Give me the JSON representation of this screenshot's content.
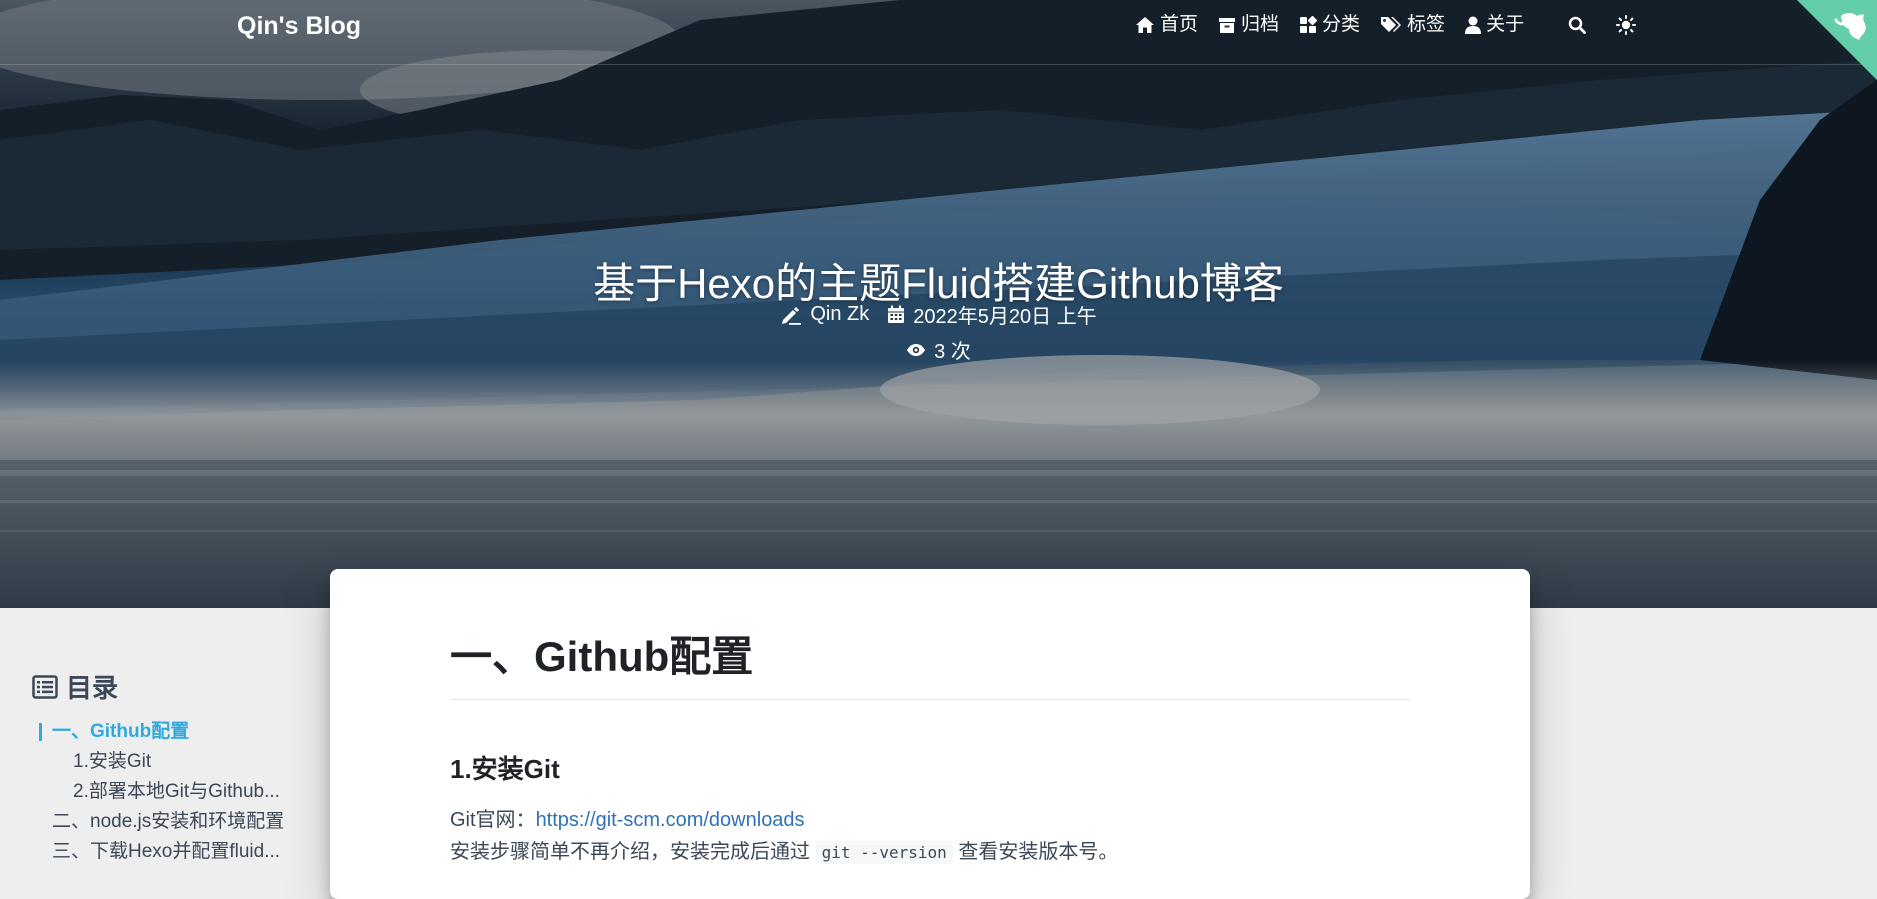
{
  "navbar": {
    "brand": "Qin's Blog",
    "items": [
      {
        "label": "首页",
        "icon": "home-icon"
      },
      {
        "label": "归档",
        "icon": "archive-icon"
      },
      {
        "label": "分类",
        "icon": "category-icon"
      },
      {
        "label": "标签",
        "icon": "tag-icon"
      },
      {
        "label": "关于",
        "icon": "user-icon"
      }
    ],
    "search_icon": "search-icon",
    "theme_icon": "sun-icon",
    "corner_icon": "github-octocat-icon"
  },
  "post": {
    "title": "基于Hexo的主题Fluid搭建Github博客",
    "author": "Qin Zk",
    "date": "2022年5月20日 上午",
    "views": "3 次"
  },
  "toc": {
    "header": "目录",
    "items": [
      {
        "label": "一、Github配置",
        "level": 1,
        "active": true
      },
      {
        "label": "1.安装Git",
        "level": 2,
        "active": false
      },
      {
        "label": "2.部署本地Git与Github...",
        "level": 2,
        "active": false
      },
      {
        "label": "二、node.js安装和环境配置",
        "level": 1,
        "active": false
      },
      {
        "label": "三、下载Hexo并配置fluid...",
        "level": 1,
        "active": false
      }
    ]
  },
  "article": {
    "h1": "一、Github配置",
    "h2": "1.安装Git",
    "git_site_prefix": "Git官网：",
    "git_site_link": "https://git-scm.com/downloads",
    "install_text_before": "安装步骤简单不再介绍，安装完成后通过",
    "install_code": "git --version",
    "install_text_after": "查看安装版本号。"
  },
  "colors": {
    "accent": "#30a9de",
    "link": "#2f72b8",
    "background": "#eeeeee",
    "card": "#ffffff"
  }
}
